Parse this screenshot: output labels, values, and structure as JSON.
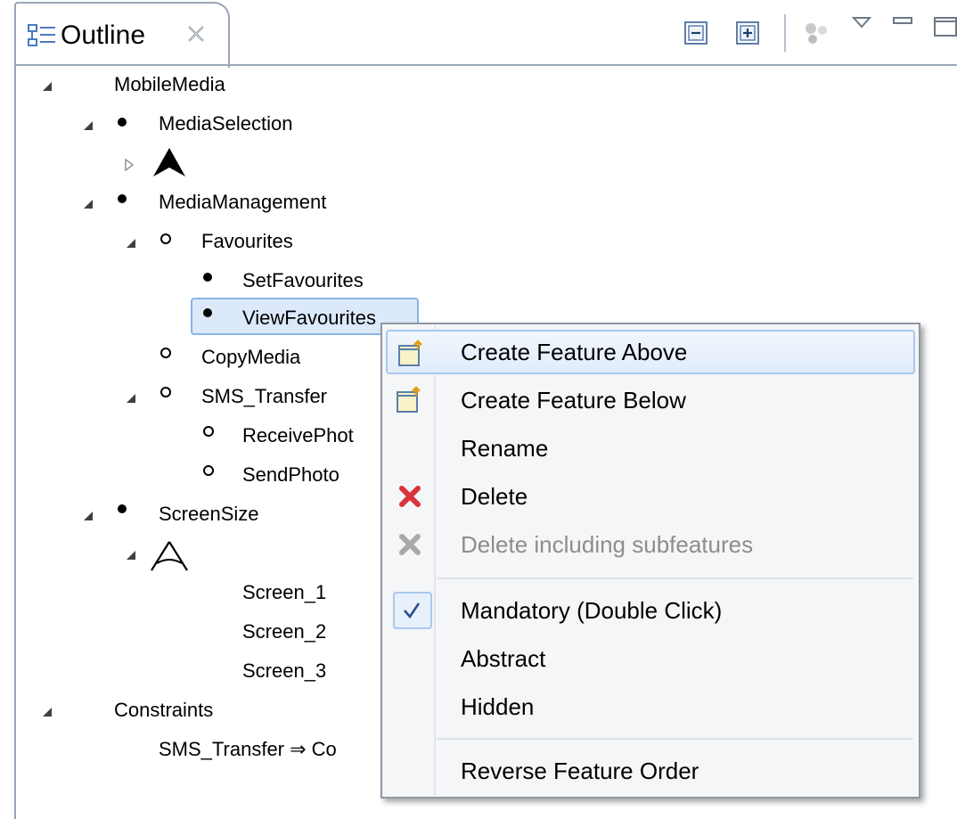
{
  "view": {
    "tab_title": "Outline",
    "tab_icon": "outline-icon",
    "close_icon": "close-icon"
  },
  "toolbar": [
    {
      "name": "collapse-all-icon"
    },
    {
      "name": "expand-all-icon"
    },
    {
      "name": "filter-icon"
    },
    {
      "name": "view-menu-icon"
    },
    {
      "name": "minimize-icon"
    },
    {
      "name": "maximize-icon"
    }
  ],
  "tree": {
    "root": "MobileMedia",
    "media_selection": "MediaSelection",
    "media_management": "MediaManagement",
    "favourites": "Favourites",
    "set_favourites": "SetFavourites",
    "view_favourites": "ViewFavourites",
    "copy_media": "CopyMedia",
    "sms_transfer": "SMS_Transfer",
    "receive_photo": "ReceivePhot",
    "send_photo": "SendPhoto",
    "screen_size": "ScreenSize",
    "screen_1": "Screen_1",
    "screen_2": "Screen_2",
    "screen_3": "Screen_3",
    "constraints": "Constraints",
    "constraint_1": "SMS_Transfer ⇒ Co"
  },
  "context_menu": {
    "create_above": "Create Feature Above",
    "create_below": "Create Feature Below",
    "rename": "Rename",
    "delete": "Delete",
    "delete_sub": "Delete including subfeatures",
    "mandatory": "Mandatory (Double Click)",
    "abstract": "Abstract",
    "hidden": "Hidden",
    "reverse": "Reverse Feature Order"
  },
  "colors": {
    "selection": "#dbe9fb",
    "selection_border": "#8ab4e6",
    "menu_bg": "#f5f6f7",
    "delete_red": "#d9343b",
    "disabled_gray": "#8d8d8d"
  }
}
